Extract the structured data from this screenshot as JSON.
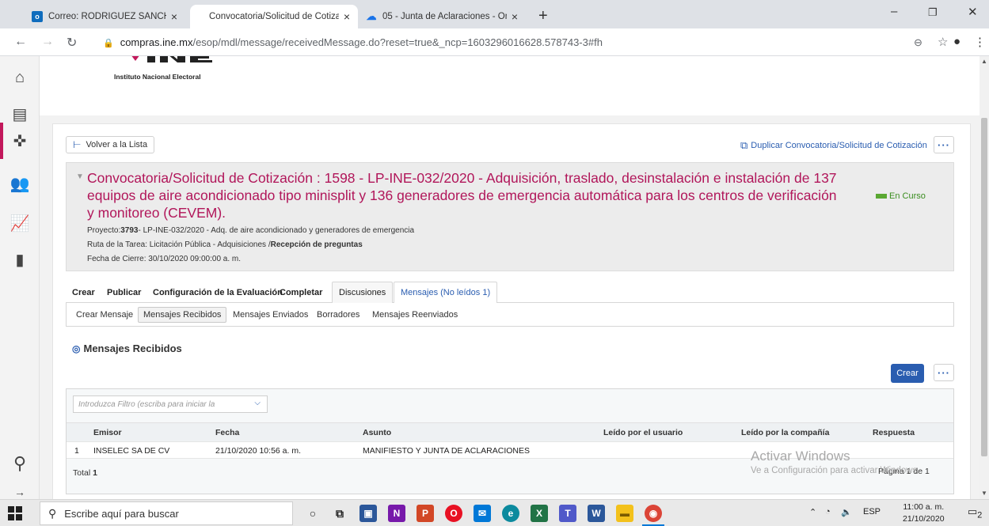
{
  "browser": {
    "tabs": [
      {
        "title": "Correo: RODRIGUEZ SANCHEZ A",
        "icon": "outlook-icon",
        "active": false
      },
      {
        "title": "Convocatoria/Solicitud de Cotiza",
        "icon": "none",
        "active": true
      },
      {
        "title": "05 - Junta de Aclaraciones - One",
        "icon": "onedrive-cloud-icon",
        "active": false
      }
    ],
    "new_tab": "+",
    "url_host": "compras.ine.mx",
    "url_path": "/esop/mdl/message/receivedMessage.do?reset=true&_ncp=1603296016628.578743-3#fh"
  },
  "logo": {
    "text": "Instituto Nacional Electoral",
    "brand_color": "#c2185b"
  },
  "actions": {
    "back": "Volver a la Lista",
    "duplicate": "Duplicar Convocatoria/Solicitud de Cotización",
    "more": "···"
  },
  "header": {
    "title": "Convocatoria/Solicitud de Cotización : 1598 - LP-INE-032/2020 - Adquisición, traslado, desinstalación e instalación de 137 equipos de aire acondicionado tipo minisplit y 136 generadores de emergencia automática para los centros de verificación y monitoreo (CEVEM).",
    "status": "En Curso",
    "project_label": "Proyecto:",
    "project_number": "3793",
    "project_rest": "- LP-INE-032/2020 - Adq. de aire acondicionado y generadores de emergencia",
    "route_label": "Ruta de la Tarea: Licitación Pública - Adquisiciones /",
    "route_bold": "Recepción de preguntas",
    "close_date": "Fecha de Cierre: 30/10/2020 09:00:00 a. m."
  },
  "main_tabs": [
    "Crear",
    "Publicar",
    "Configuración de la Evaluación",
    "Completar",
    "Discusiones",
    "Mensajes (No leídos 1)"
  ],
  "sub_tabs": [
    "Crear Mensaje",
    "Mensajes Recibidos",
    "Mensajes Enviados",
    "Borradores",
    "Mensajes Reenviados"
  ],
  "section_title": "Mensajes Recibidos",
  "create_button": "Crear",
  "grid": {
    "filter_placeholder": "Introduzca Filtro (escriba para iniciar la",
    "columns": [
      "Emisor",
      "Fecha",
      "Asunto",
      "Leído por el usuario",
      "Leído por la compañía",
      "Respuesta"
    ],
    "rows": [
      {
        "num": "1",
        "emisor": "INSELEC SA DE CV",
        "fecha": "21/10/2020 10:56 a. m.",
        "asunto": "MANIFIESTO Y JUNTA DE ACLARACIONES"
      }
    ],
    "total_label": "Total",
    "total_value": "1",
    "pager": "Página 1 de 1"
  },
  "watermark": {
    "line1": "Activar Windows",
    "line2": "Ve a Configuración para activar Windows."
  },
  "taskbar": {
    "search_placeholder": "Escribe aquí para buscar",
    "language": "ESP",
    "time": "11:00 a. m.",
    "date": "21/10/2020",
    "notifications": "2"
  }
}
